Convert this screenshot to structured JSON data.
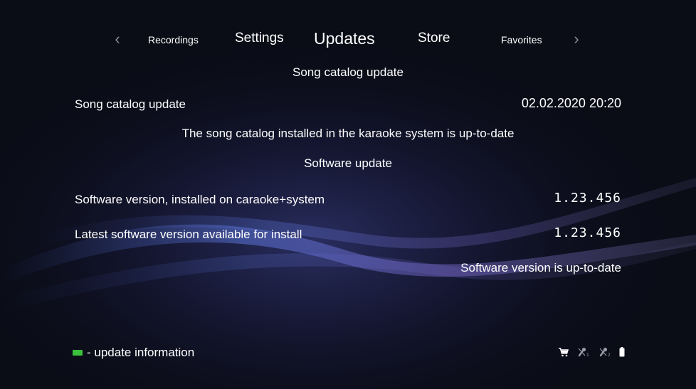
{
  "nav": {
    "tabs": [
      {
        "label": "Recordings"
      },
      {
        "label": "Settings"
      },
      {
        "label": "Updates",
        "active": true
      },
      {
        "label": "Store"
      },
      {
        "label": "Favorites"
      }
    ],
    "prev_icon": "chevron-left-icon",
    "next_icon": "chevron-right-icon"
  },
  "catalog": {
    "section_title": "Song catalog update",
    "label": "Song catalog update",
    "date": "02.02.2020 20:20",
    "status": "The song catalog installed in the karaoke system is up-to-date"
  },
  "software": {
    "section_title": "Software update",
    "installed_label": "Software version, installed on caraoke+system",
    "installed_value": "1.23.456",
    "latest_label": "Latest software version available for install",
    "latest_value": "1.23.456",
    "status": "Software version is up-to-date"
  },
  "legend": {
    "text": "- update information",
    "swatch_color": "#3ac03a"
  },
  "status_icons": [
    "cart-icon",
    "microphone-1-muted-icon",
    "microphone-2-muted-icon",
    "battery-icon"
  ],
  "colors": {
    "background": "#0a0c16",
    "text": "#ffffff",
    "accent_green": "#3ac03a"
  }
}
